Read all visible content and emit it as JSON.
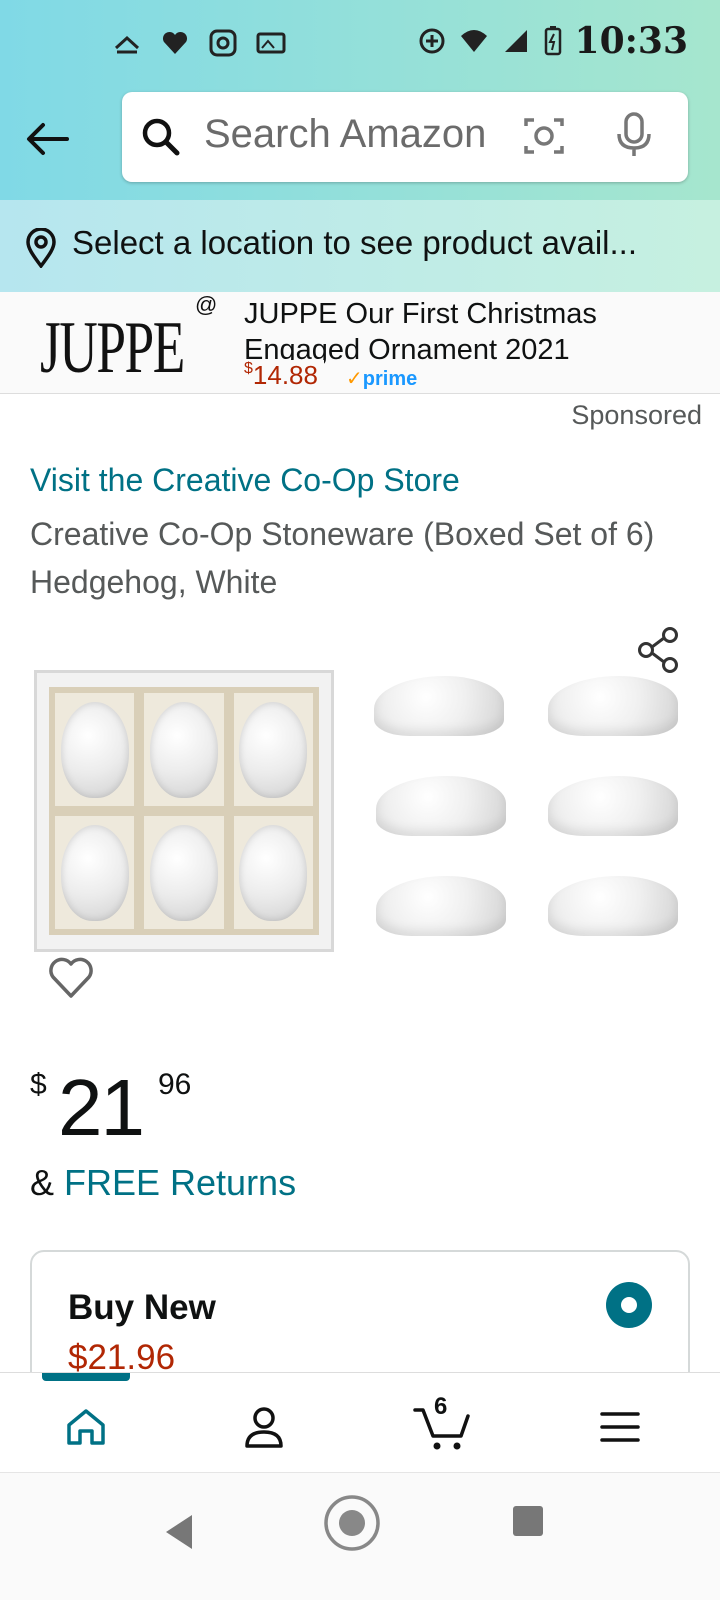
{
  "status_bar": {
    "time": "10:33"
  },
  "search": {
    "placeholder": "Search Amazon"
  },
  "location": {
    "text": "Select a location to see product avail..."
  },
  "sponsored_ad": {
    "brand_logo": "JUPPE",
    "brand_mark": "@",
    "title": "JUPPE Our First Christmas Engaged Ornament 2021",
    "price_symbol": "$",
    "price": "14.88",
    "prime_label": "prime"
  },
  "sponsored_label": "Sponsored",
  "product": {
    "store_link": "Visit the Creative Co-Op Store",
    "title": "Creative Co-Op Stoneware (Boxed Set of 6) Hedgehog, White",
    "price": {
      "symbol": "$",
      "whole": "21",
      "fraction": "96"
    },
    "returns_prefix": "& ",
    "returns_link": "FREE Returns"
  },
  "buy_option": {
    "title": "Buy New",
    "price": "$21.96"
  },
  "bottom_nav": {
    "cart_count": "6"
  },
  "colors": {
    "link": "#007185",
    "price_red": "#b12704",
    "header_gradient_start": "#80d9e6",
    "header_gradient_end": "#a6e6ce"
  }
}
